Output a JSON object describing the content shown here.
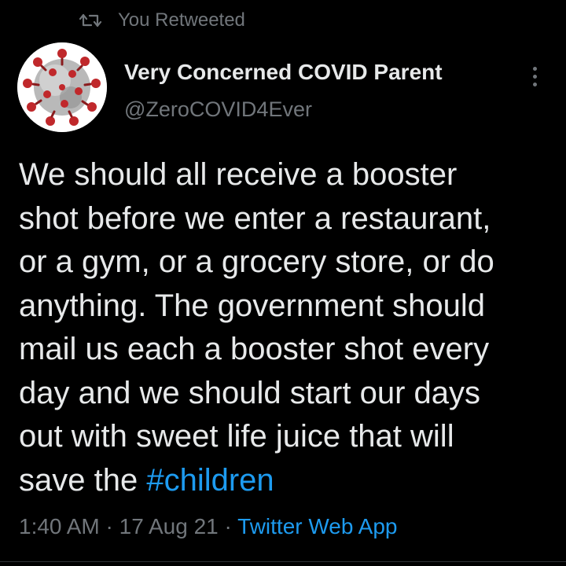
{
  "retweet": {
    "icon": "retweet-icon",
    "label": "You Retweeted"
  },
  "author": {
    "avatar_icon": "coronavirus-avatar",
    "display_name": "Very Concerned COVID Parent",
    "handle": "@ZeroCOVID4Ever"
  },
  "menu": {
    "icon": "more-vertical-icon"
  },
  "tweet": {
    "lines": [
      "We should all receive a booster",
      "shot before we enter a restaurant,",
      "or a gym, or a grocery store, or do",
      "anything. The government should",
      "mail us each a booster shot every",
      "day and we should start our days",
      "out with sweet life juice that will",
      "save the "
    ],
    "hashtag": "#children"
  },
  "meta": {
    "time": "1:40 AM",
    "separator": " · ",
    "date": "17 Aug 21",
    "source": "Twitter Web App"
  },
  "colors": {
    "background": "#000000",
    "text": "#e7e9ea",
    "muted": "#71767b",
    "link": "#1d9bf0",
    "divider": "#2f3336"
  }
}
